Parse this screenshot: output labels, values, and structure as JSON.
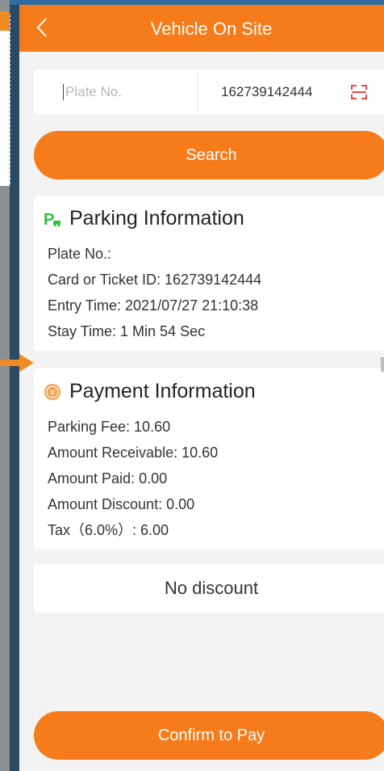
{
  "nav": {
    "title": "Vehicle On Site"
  },
  "search": {
    "plate_placeholder": "Plate No.",
    "card_number": "162739142444",
    "button_label": "Search"
  },
  "parking": {
    "title": "Parking Information",
    "lines": [
      "Plate No.:",
      "Card or Ticket ID: 162739142444",
      "Entry Time: 2021/07/27 21:10:38",
      "Stay Time: 1 Min 54 Sec"
    ]
  },
  "payment": {
    "title": "Payment Information",
    "lines": [
      "Parking Fee: 10.60",
      "Amount Receivable: 10.60",
      "Amount Paid: 0.00",
      "Amount Discount: 0.00",
      "Tax（6.0%）: 6.00"
    ]
  },
  "discount": {
    "label": "No discount"
  },
  "confirm": {
    "label": "Confirm to Pay"
  },
  "icons": {
    "back": "chevron-left-icon",
    "scan": "scan-icon",
    "parking": "parking-car-icon",
    "payment": "coin-icon"
  },
  "colors": {
    "accent": "#f57b1b",
    "parking_icon": "#2ec23a",
    "payment_icon": "#f5a04b"
  }
}
